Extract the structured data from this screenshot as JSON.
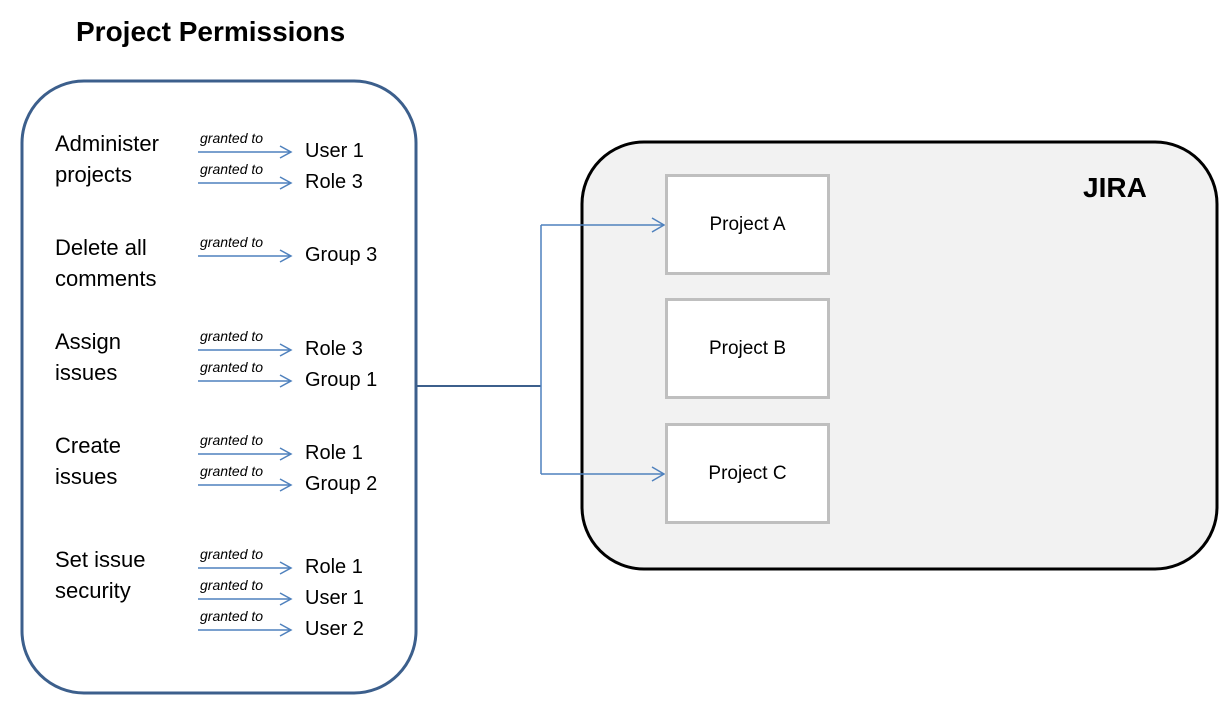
{
  "title": "Project Permissions",
  "edge_label": "granted to",
  "permissions": [
    {
      "name": "Administer\nprojects",
      "grants": [
        "User 1",
        "Role 3"
      ]
    },
    {
      "name": "Delete all\ncomments",
      "grants": [
        "Group 3"
      ]
    },
    {
      "name": "Assign\nissues",
      "grants": [
        "Role 3",
        "Group 1"
      ]
    },
    {
      "name": "Create\nissues",
      "grants": [
        "Role 1",
        "Group 2"
      ]
    },
    {
      "name": "Set issue\nsecurity",
      "grants": [
        "Role 1",
        "User 1",
        "User 2"
      ]
    }
  ],
  "jira": {
    "label": "JIRA",
    "projects": [
      "Project A",
      "Project B",
      "Project C"
    ],
    "connected_projects": [
      "Project A",
      "Project C"
    ]
  },
  "colors": {
    "permissions_border": "#3c5f8c",
    "arrow": "#4f81bd",
    "jira_border": "#000000",
    "jira_fill": "#f2f2f2",
    "project_border": "#bfbfbf"
  }
}
